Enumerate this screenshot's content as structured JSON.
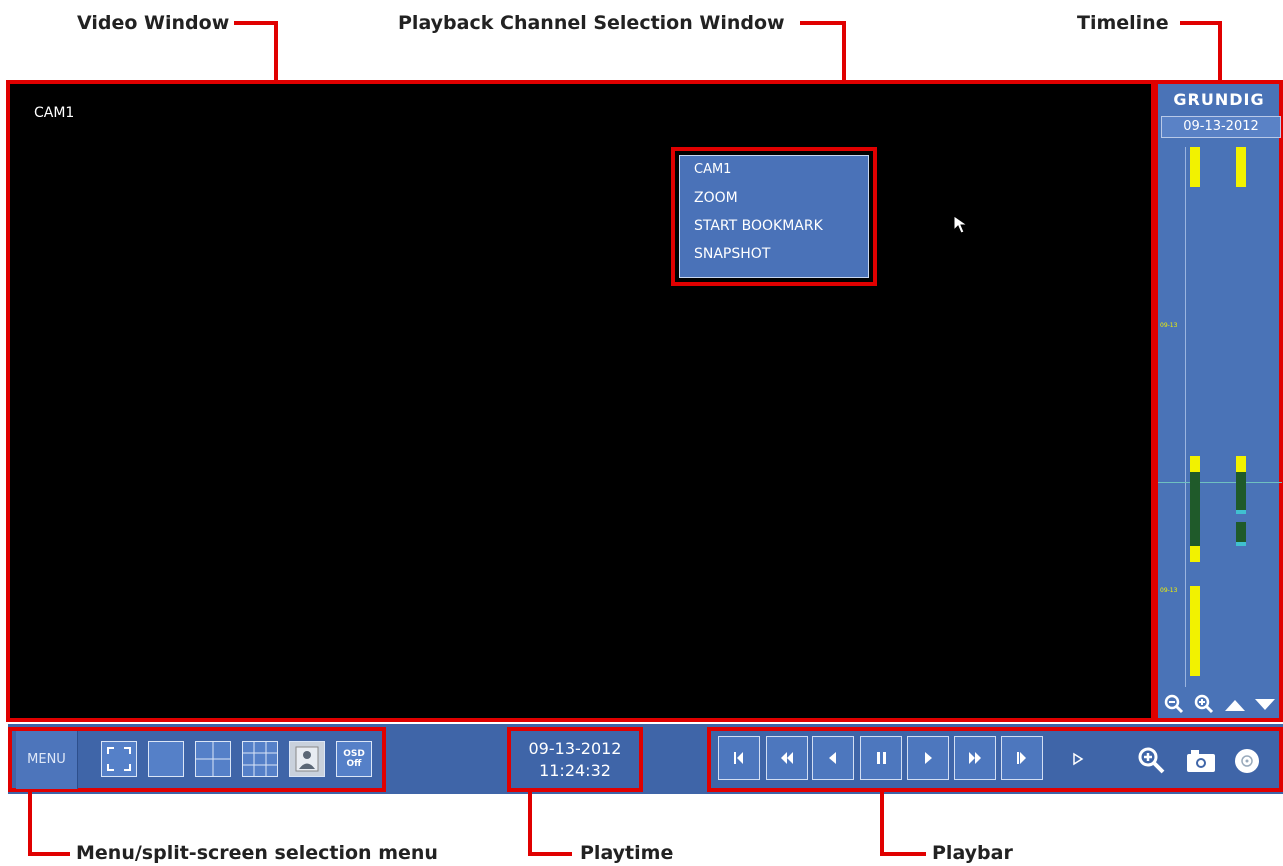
{
  "callouts": {
    "video_window": "Video Window",
    "channel_window": "Playback Channel Selection Window",
    "timeline": "Timeline",
    "menu": "Menu/split-screen selection menu",
    "playtime": "Playtime",
    "playbar": "Playbar"
  },
  "video": {
    "camera_label": "CAM1"
  },
  "popup": {
    "items": [
      "CAM1",
      "ZOOM",
      "START BOOKMARK",
      "SNAPSHOT"
    ]
  },
  "timeline": {
    "brand": "GRUNDIG",
    "date": "09-13-2012",
    "marker_labels": [
      "09-13",
      "09-13"
    ],
    "zoom_out_icon": "zoom-out-icon",
    "zoom_in_icon": "zoom-in-icon",
    "up_icon": "up-arrow-icon",
    "down_icon": "down-arrow-icon"
  },
  "bottom": {
    "menu_label": "MENU",
    "split_buttons": [
      "fullscreen",
      "1-split",
      "4-split",
      "9-split",
      "single-user",
      "OSD Off"
    ],
    "osd_label_1": "OSD",
    "osd_label_2": "Off",
    "playtime_date": "09-13-2012",
    "playtime_time": "11:24:32",
    "playbar": [
      "step-back",
      "fast-rewind",
      "play-reverse",
      "pause",
      "play",
      "fast-forward",
      "step-forward",
      "slow-play",
      "zoom",
      "snapshot",
      "record"
    ]
  },
  "colors": {
    "panel_blue": "#3f65a8",
    "highlight_red": "#e00000",
    "timeline_yellow": "#f2f200",
    "timeline_green": "#1f5a2a"
  }
}
